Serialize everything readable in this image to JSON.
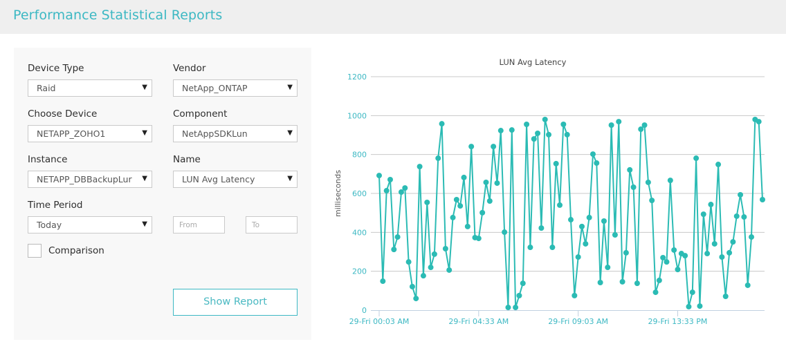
{
  "header": {
    "title": "Performance Statistical Reports"
  },
  "form": {
    "device_type": {
      "label": "Device Type",
      "value": "Raid"
    },
    "vendor": {
      "label": "Vendor",
      "value": "NetApp_ONTAP"
    },
    "choose_device": {
      "label": "Choose Device",
      "value": "NETAPP_ZOHO1"
    },
    "component": {
      "label": "Component",
      "value": "NetAppSDKLun"
    },
    "instance": {
      "label": "Instance",
      "value": "NETAPP_DBBackupLur"
    },
    "name": {
      "label": "Name",
      "value": "LUN Avg Latency"
    },
    "time_period": {
      "label": "Time Period",
      "value": "Today"
    },
    "from": {
      "placeholder": "From",
      "value": ""
    },
    "to": {
      "placeholder": "To",
      "value": ""
    },
    "comparison": {
      "label": "Comparison",
      "checked": false
    },
    "arrow_glyph": "▼",
    "show_report_label": "Show Report"
  },
  "colors": {
    "accent": "#3cb8c3",
    "line": "#2bbbb4",
    "grid": "#c8c8c8"
  },
  "chart_data": {
    "type": "line",
    "title": "LUN Avg Latency",
    "xlabel": "",
    "ylabel": "milliseconds",
    "ylim": [
      0,
      1200
    ],
    "yticks": [
      0,
      200,
      400,
      600,
      800,
      1000,
      1200
    ],
    "xtick_labels": [
      "29-Fri 00:03 AM",
      "29-Fri 04:33 AM",
      "29-Fri 09:03 AM",
      "29-Fri 13:33 PM"
    ],
    "xtick_indices": [
      0,
      27,
      54,
      81
    ],
    "grid": true,
    "legend": "none",
    "series": [
      {
        "name": "LUN Avg Latency",
        "values": [
          692,
          149,
          614,
          671,
          312,
          376,
          607,
          628,
          248,
          121,
          60,
          738,
          177,
          554,
          220,
          288,
          781,
          958,
          316,
          206,
          476,
          568,
          536,
          682,
          430,
          841,
          373,
          369,
          501,
          657,
          561,
          841,
          653,
          923,
          401,
          14,
          926,
          14,
          75,
          138,
          955,
          323,
          880,
          909,
          422,
          980,
          902,
          323,
          753,
          540,
          955,
          902,
          465,
          75,
          273,
          430,
          341,
          476,
          802,
          756,
          142,
          458,
          220,
          951,
          387,
          969,
          146,
          295,
          721,
          632,
          138,
          930,
          951,
          657,
          564,
          92,
          153,
          270,
          248,
          667,
          309,
          209,
          291,
          280,
          18,
          92,
          781,
          21,
          493,
          291,
          543,
          341,
          749,
          273,
          71,
          295,
          351,
          483,
          593,
          479,
          128,
          376,
          980,
          969,
          568
        ]
      }
    ]
  }
}
